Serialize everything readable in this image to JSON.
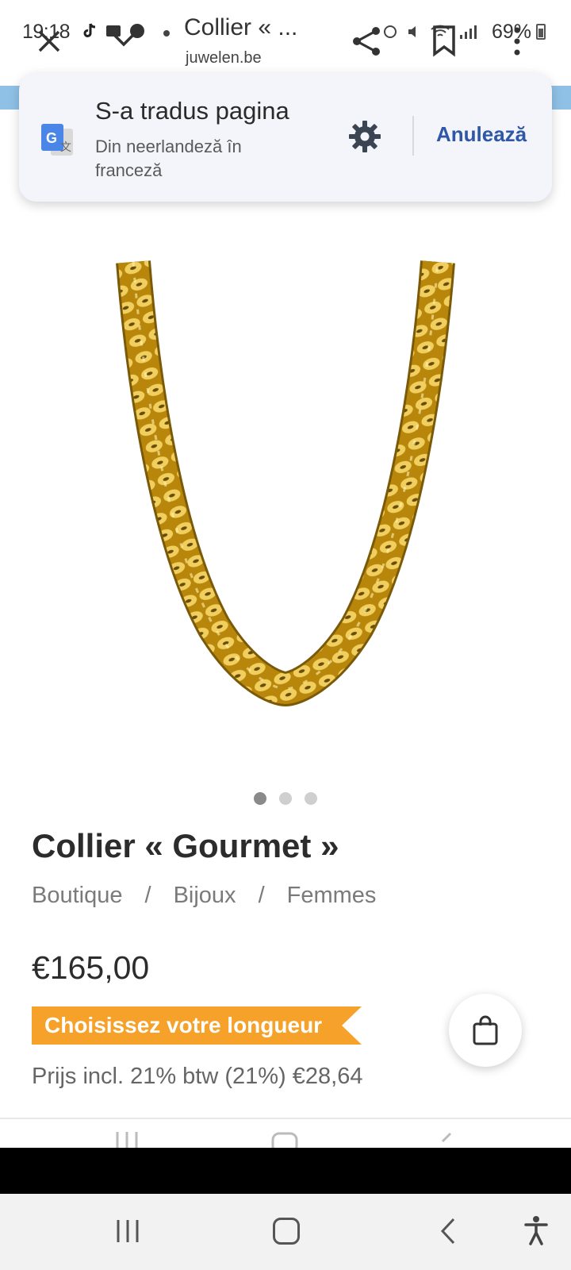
{
  "status_bar": {
    "time": "19:18",
    "battery": "69%"
  },
  "toolbar": {
    "page_title": "Collier « ...",
    "domain": "juwelen.be"
  },
  "translate_popup": {
    "title": "S-a tradus pagina",
    "subtitle": "Din neerlandeză în franceză",
    "cancel_label": "Anulează"
  },
  "product": {
    "image_pager": {
      "count": 3,
      "active": 1
    },
    "title": "Collier « Gourmet »",
    "breadcrumb": [
      "Boutique",
      "Bijoux",
      "Femmes"
    ],
    "breadcrumb_separator": "/",
    "price": "€165,00",
    "length_label": "Choisissez votre longueur",
    "vat_line": "Prijs incl. 21% btw (21%) €28,64"
  },
  "colors": {
    "accent_orange": "#f6a12a",
    "link_blue": "#2f57a5",
    "gold": "#c99a1e"
  },
  "icons": {
    "toolbar": [
      "close-icon",
      "check-dropdown-icon",
      "share-icon",
      "bookmark-icon",
      "more-vert-icon"
    ],
    "translate": [
      "google-translate-icon",
      "gear-icon"
    ],
    "cart": "shopping-bag-icon",
    "system_nav": [
      "recents-icon",
      "home-icon",
      "back-icon",
      "accessibility-icon"
    ]
  }
}
